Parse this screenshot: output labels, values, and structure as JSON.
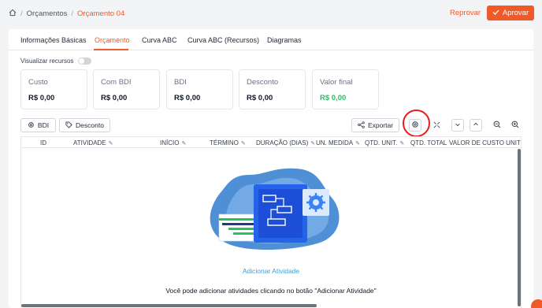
{
  "breadcrumb": {
    "home_icon": "home-icon",
    "items": [
      "Orçamentos",
      "Orçamento 04"
    ],
    "separator": "/"
  },
  "header": {
    "reject_label": "Reprovar",
    "approve_label": "Aprovar"
  },
  "tabs": [
    {
      "label": "Informações Básicas",
      "active": false
    },
    {
      "label": "Orçamento",
      "active": true
    },
    {
      "label": "Curva ABC",
      "active": false
    },
    {
      "label": "Curva ABC (Recursos)",
      "active": false
    },
    {
      "label": "Diagramas",
      "active": false
    }
  ],
  "toggle": {
    "label": "Visualizar recursos",
    "on": false
  },
  "stats": [
    {
      "label": "Custo",
      "value": "R$ 0,00"
    },
    {
      "label": "Com BDI",
      "value": "R$ 0,00"
    },
    {
      "label": "BDI",
      "value": "R$ 0,00"
    },
    {
      "label": "Desconto",
      "value": "R$ 0,00"
    },
    {
      "label": "Valor final",
      "value": "R$ 0,00",
      "color": "#22c55e"
    }
  ],
  "toolbar": {
    "bdi_label": "BDI",
    "desconto_label": "Desconto",
    "exportar_label": "Exportar",
    "icons": [
      "gear-icon",
      "fullscreen-icon",
      "collapse-down-icon",
      "collapse-up-icon",
      "zoom-out-icon",
      "zoom-in-icon"
    ]
  },
  "table": {
    "columns": [
      "ID",
      "ATIVIDADE",
      "INÍCIO",
      "TÉRMINO",
      "DURAÇÃO (DIAS)",
      "UN. MEDIDA",
      "QTD. UNIT.",
      "QTD. TOTAL",
      "VALOR DE CUSTO UNIT"
    ]
  },
  "empty_state": {
    "link": "Adicionar Atividade",
    "text": "Você pode adicionar atividades clicando no botão \"Adicionar Atividade\""
  },
  "colors": {
    "accent": "#f05a28",
    "positive": "#22c55e",
    "link": "#3b9ed8"
  }
}
